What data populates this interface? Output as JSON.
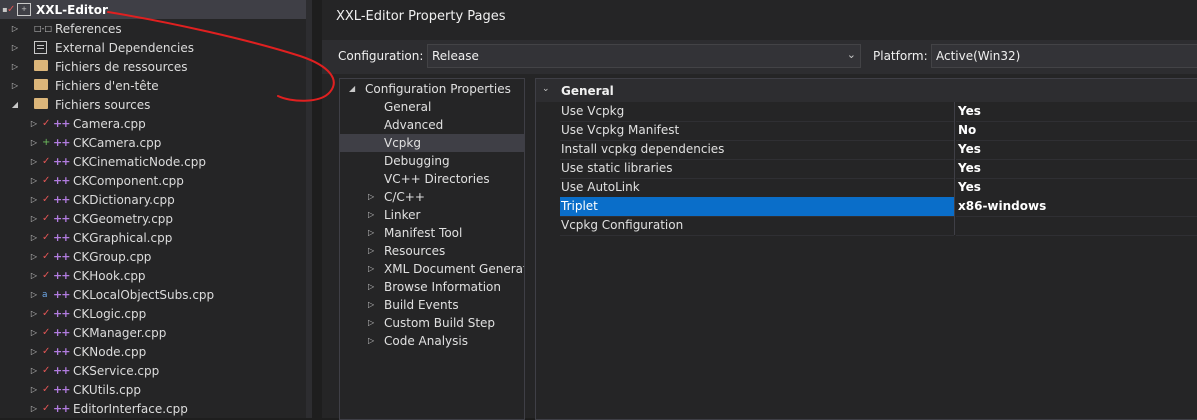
{
  "solution_explorer": {
    "root": "XXL-Editor",
    "items": [
      {
        "label": "References",
        "kind": "references",
        "expander": "collapsed"
      },
      {
        "label": "External Dependencies",
        "kind": "external",
        "expander": "collapsed"
      },
      {
        "label": "Fichiers de ressources",
        "kind": "filter",
        "expander": "collapsed"
      },
      {
        "label": "Fichiers d'en-tête",
        "kind": "filter",
        "expander": "collapsed"
      },
      {
        "label": "Fichiers sources",
        "kind": "filter",
        "expander": "expanded"
      }
    ],
    "files": [
      {
        "label": "Camera.cpp",
        "status": "checked"
      },
      {
        "label": "CKCamera.cpp",
        "status": "added"
      },
      {
        "label": "CKCinematicNode.cpp",
        "status": "checked"
      },
      {
        "label": "CKComponent.cpp",
        "status": "checked"
      },
      {
        "label": "CKDictionary.cpp",
        "status": "checked"
      },
      {
        "label": "CKGeometry.cpp",
        "status": "checked"
      },
      {
        "label": "CKGraphical.cpp",
        "status": "checked"
      },
      {
        "label": "CKGroup.cpp",
        "status": "checked"
      },
      {
        "label": "CKHook.cpp",
        "status": "checked"
      },
      {
        "label": "CKLocalObjectSubs.cpp",
        "status": "locked"
      },
      {
        "label": "CKLogic.cpp",
        "status": "checked"
      },
      {
        "label": "CKManager.cpp",
        "status": "checked"
      },
      {
        "label": "CKNode.cpp",
        "status": "checked"
      },
      {
        "label": "CKService.cpp",
        "status": "checked"
      },
      {
        "label": "CKUtils.cpp",
        "status": "checked"
      },
      {
        "label": "EditorInterface.cpp",
        "status": "checked"
      }
    ]
  },
  "dialog": {
    "title": "XXL-Editor Property Pages",
    "configuration_label": "Configuration:",
    "configuration_value": "Release",
    "platform_label": "Platform:",
    "platform_value": "Active(Win32)",
    "tree": {
      "root": "Configuration Properties",
      "items": [
        {
          "label": "General",
          "expandable": false,
          "selected": false
        },
        {
          "label": "Advanced",
          "expandable": false,
          "selected": false
        },
        {
          "label": "Vcpkg",
          "expandable": false,
          "selected": true
        },
        {
          "label": "Debugging",
          "expandable": false,
          "selected": false
        },
        {
          "label": "VC++ Directories",
          "expandable": false,
          "selected": false
        },
        {
          "label": "C/C++",
          "expandable": true,
          "selected": false
        },
        {
          "label": "Linker",
          "expandable": true,
          "selected": false
        },
        {
          "label": "Manifest Tool",
          "expandable": true,
          "selected": false
        },
        {
          "label": "Resources",
          "expandable": true,
          "selected": false
        },
        {
          "label": "XML Document Generator",
          "expandable": true,
          "selected": false
        },
        {
          "label": "Browse Information",
          "expandable": true,
          "selected": false
        },
        {
          "label": "Build Events",
          "expandable": true,
          "selected": false
        },
        {
          "label": "Custom Build Step",
          "expandable": true,
          "selected": false
        },
        {
          "label": "Code Analysis",
          "expandable": true,
          "selected": false
        }
      ]
    },
    "grid": {
      "section": "General",
      "rows": [
        {
          "name": "Use Vcpkg",
          "value": "Yes",
          "selected": false
        },
        {
          "name": "Use Vcpkg Manifest",
          "value": "No",
          "selected": false
        },
        {
          "name": "Install vcpkg dependencies",
          "value": "Yes",
          "selected": false
        },
        {
          "name": "Use static libraries",
          "value": "Yes",
          "selected": false
        },
        {
          "name": "Use AutoLink",
          "value": "Yes",
          "selected": false
        },
        {
          "name": "Triplet",
          "value": "x86-windows",
          "selected": true
        },
        {
          "name": "Vcpkg Configuration",
          "value": "",
          "selected": false
        }
      ]
    }
  },
  "colors": {
    "selection_blue": "#0a6ec9",
    "annotation_red": "#e02020"
  }
}
